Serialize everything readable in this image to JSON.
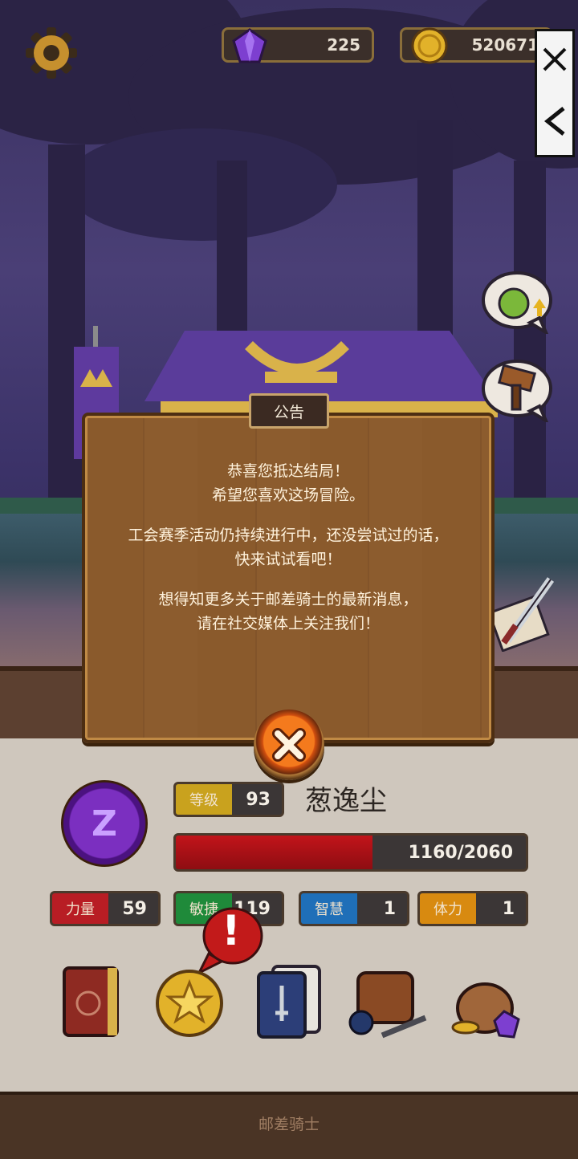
{
  "currency": {
    "gems": "225",
    "gold": "520671"
  },
  "notice": {
    "title": "公告",
    "lines": [
      "恭喜您抵达结局！",
      "希望您喜欢这场冒险。",
      "工会赛季活动仍持续进行中，还没尝试过的话，",
      "快来试试看吧！",
      "想得知更多关于邮差骑士的最新消息，",
      "请在社交媒体上关注我们！"
    ]
  },
  "character": {
    "name": "葱逸尘",
    "emblem_letter": "Z",
    "level_label": "等级",
    "level": "93",
    "hp_text": "1160/2060",
    "hp_fraction": 0.563
  },
  "stats": [
    {
      "label": "力量",
      "value": "59",
      "color": "#b81d24"
    },
    {
      "label": "敏捷",
      "value": "119",
      "color": "#1f8a3a"
    },
    {
      "label": "智慧",
      "value": "1",
      "color": "#1f6fb8"
    },
    {
      "label": "体力",
      "value": "1",
      "color": "#d88a10"
    }
  ],
  "alert_mark": "!",
  "footer": {
    "brand": "邮差骑士"
  },
  "colors": {
    "board": "#8a5a2c",
    "close_button": "#f47a1d",
    "hp_bar": "#c2141a"
  }
}
